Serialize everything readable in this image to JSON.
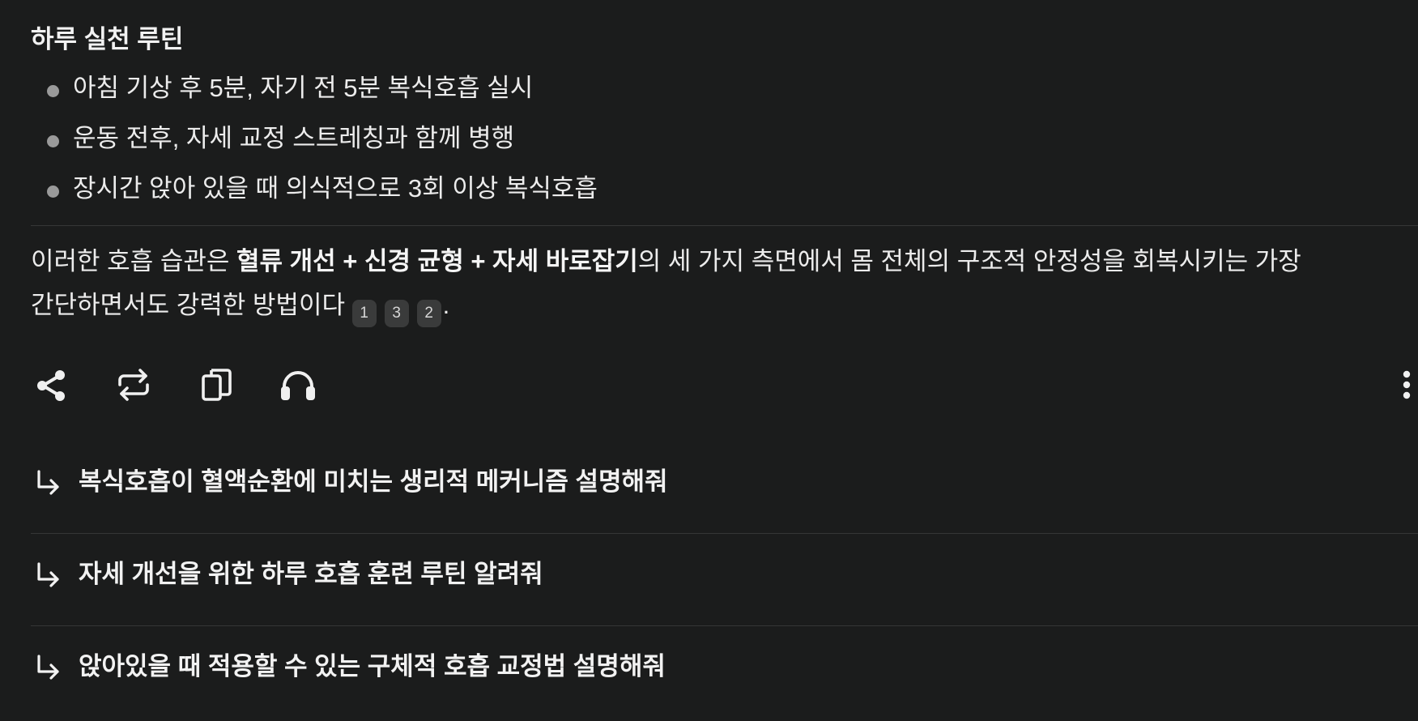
{
  "section": {
    "title": "하루 실천 루틴"
  },
  "bullets": [
    "아침 기상 후 5분, 자기 전 5분 복식호흡 실시",
    "운동 전후, 자세 교정 스트레칭과 함께 병행",
    "장시간 앉아 있을 때 의식적으로 3회 이상 복식호흡"
  ],
  "paragraph": {
    "line1_pre": "이러한 호흡 습관은 ",
    "line1_bold": "혈류 개선 + 신경 균형 + 자세 바로잡기",
    "line1_post": "의 세 가지 측면에서 몸 전체의 구조적 안정성을 회복시키는 가장",
    "line2_text": "간단하면서도 강력한 방법이다 ",
    "citations": [
      "1",
      "3",
      "2"
    ],
    "line2_end": "."
  },
  "actions": {
    "icons": [
      "share-icon",
      "regenerate-icon",
      "copy-icon",
      "headphones-icon",
      "more-vertical-icon"
    ]
  },
  "followups": [
    "복식호흡이 혈액순환에 미치는 생리적 메커니즘 설명해줘",
    "자세 개선을 위한 하루 호흡 훈련 루틴 알려줘",
    "앉아있을 때 적용할 수 있는 구체적 호흡 교정법 설명해줘"
  ],
  "colors": {
    "background": "#1b1c1c",
    "text": "#ececec",
    "divider": "#353636",
    "bullet": "#9a9a9a",
    "citation_badge": "#3a3b3b"
  }
}
